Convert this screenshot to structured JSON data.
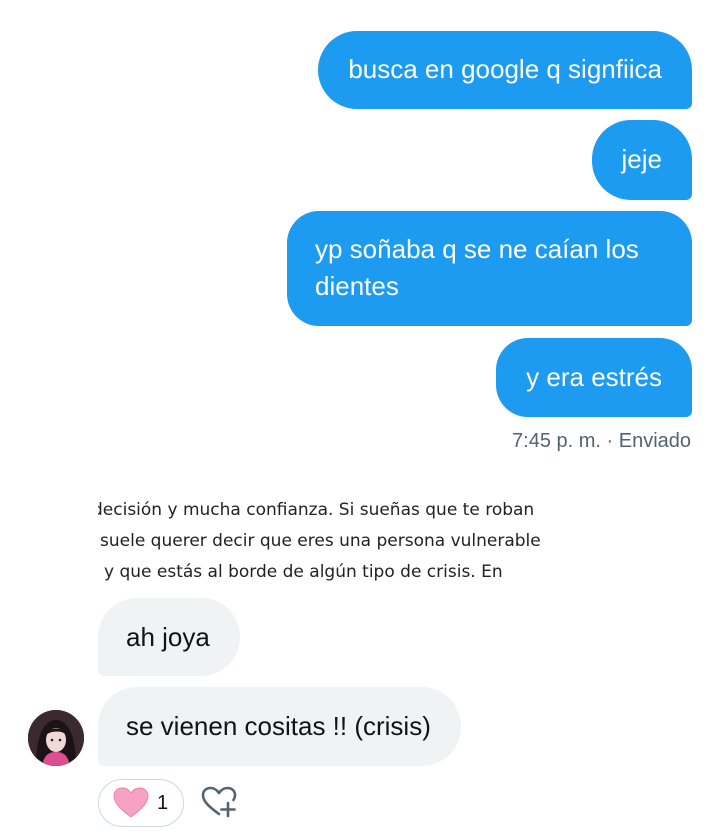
{
  "conversation": {
    "sent_messages": [
      "busca en google q signfiica",
      "jeje",
      "yp soñaba q se ne caían los dientes",
      "y era estrés"
    ],
    "sent_meta": "7:45 p. m. · Enviado",
    "quoted_image_text": [
      "decisión y mucha confianza. Si sueñas que te roban",
      "suele querer decir que eres una persona vulnerable",
      "y que estás al borde de algún tipo de crisis. En"
    ],
    "received_messages": [
      "ah joya",
      "se vienen cositas !! (crisis)"
    ],
    "reaction": {
      "emoji": "pink-heart",
      "count": "1"
    },
    "add_reaction_icon": "heart-plus-icon"
  },
  "colors": {
    "sent_bubble": "#1d9bf0",
    "received_bubble": "#eff3f4",
    "meta_text": "#536471",
    "reaction_heart": "#f7a1c4"
  }
}
